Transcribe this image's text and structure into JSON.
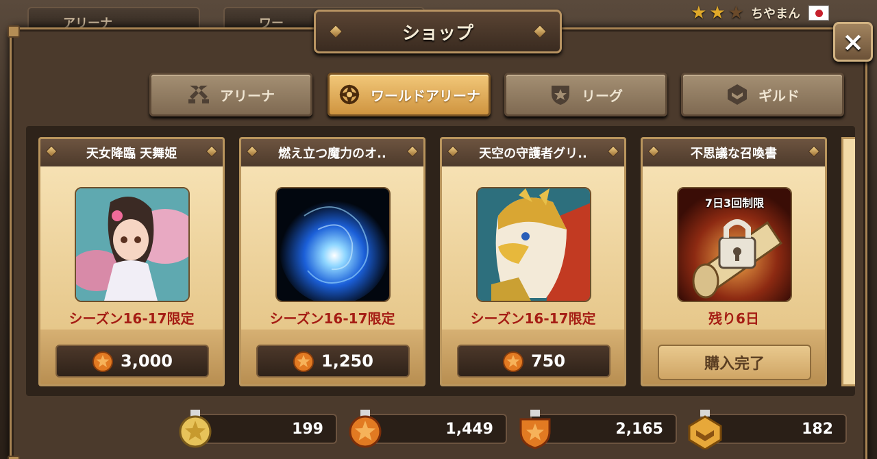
{
  "background": {
    "tab1_label": "アリーナ",
    "tab2_label": "ワー"
  },
  "player": {
    "stars": [
      true,
      true,
      false
    ],
    "name": "ちやまん"
  },
  "shop": {
    "title": "ショップ",
    "close_label": "×",
    "tabs": [
      {
        "label": "アリーナ",
        "icon": "crossed-swords-icon",
        "active": false
      },
      {
        "label": "ワールドアリーナ",
        "icon": "world-arena-icon",
        "active": true
      },
      {
        "label": "リーグ",
        "icon": "league-shield-icon",
        "active": false
      },
      {
        "label": "ギルド",
        "icon": "guild-emblem-icon",
        "active": false
      }
    ],
    "items": [
      {
        "name": "天女降臨 天舞姫",
        "limit": "シーズン16-17限定",
        "price": "3,000",
        "image": "celestial-maiden-portrait",
        "bought": false
      },
      {
        "name": "燃え立つ魔力のオ..",
        "limit": "シーズン16-17限定",
        "price": "1,250",
        "image": "blue-magic-orb",
        "bought": false
      },
      {
        "name": "天空の守護者グリ..",
        "limit": "シーズン16-17限定",
        "price": "750",
        "image": "griffon-guardian-portrait",
        "bought": false
      },
      {
        "name": "不思議な召喚書",
        "limit": "残り6日",
        "badge": "7日3回制限",
        "image": "locked-scroll",
        "button_label": "購入完了",
        "bought": true
      }
    ]
  },
  "currencies": [
    {
      "icon": "gold-star-medal-icon",
      "value": "199"
    },
    {
      "icon": "orange-star-medal-icon",
      "value": "1,449"
    },
    {
      "icon": "shield-star-medal-icon",
      "value": "2,165"
    },
    {
      "icon": "guild-medal-icon",
      "value": "182"
    }
  ],
  "colors": {
    "accent": "#cf9440",
    "limit_red": "#a51d14",
    "panel": "#4b3a2c"
  }
}
